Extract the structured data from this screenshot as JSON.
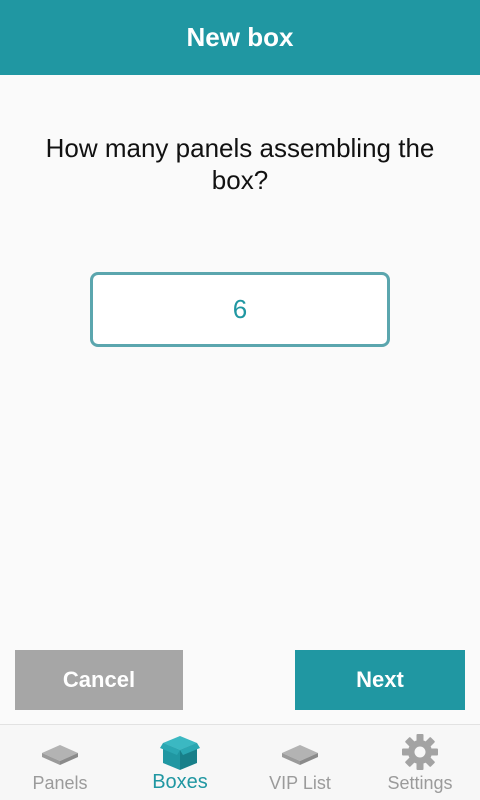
{
  "header": {
    "title": "New box"
  },
  "question": {
    "text": "How many panels assembling the box?"
  },
  "panel_count": {
    "value": "6"
  },
  "actions": {
    "cancel_label": "Cancel",
    "next_label": "Next"
  },
  "nav": {
    "items": [
      {
        "label": "Panels",
        "icon": "panel-icon",
        "active": false
      },
      {
        "label": "Boxes",
        "icon": "box-icon",
        "active": true
      },
      {
        "label": "VIP List",
        "icon": "panel-icon",
        "active": false
      },
      {
        "label": "Settings",
        "icon": "gear-icon",
        "active": false
      }
    ]
  },
  "colors": {
    "accent": "#2097a2",
    "muted": "#9b9b9b",
    "cancel": "#a6a6a6"
  }
}
